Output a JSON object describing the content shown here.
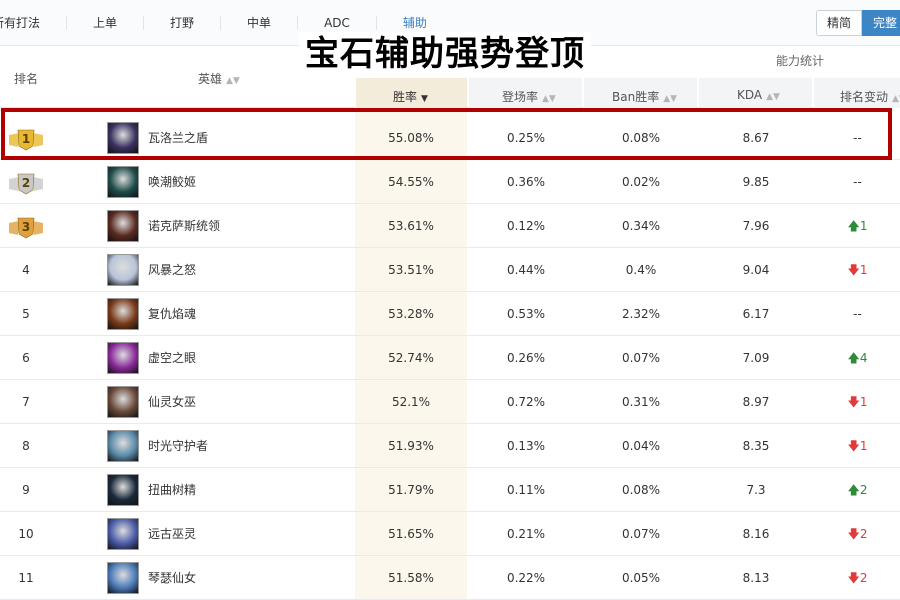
{
  "tabs": [
    "所有打法",
    "上单",
    "打野",
    "中单",
    "ADC",
    "辅助"
  ],
  "active_tab": "辅助",
  "view_toggle": [
    "精简",
    "完整"
  ],
  "overlay_title": "宝石辅助强势登顶",
  "header": {
    "rank": "排名",
    "hero": "英雄",
    "ability": "能力统计",
    "winrate": "胜率",
    "pickrate": "登场率",
    "banrate": "Ban胜率",
    "kda": "KDA",
    "rank_change": "排名变动"
  },
  "rows": [
    {
      "rank": "1",
      "medal": "gold",
      "hero": "瓦洛兰之盾",
      "win": "55.08%",
      "pick": "0.25%",
      "ban": "0.08%",
      "kda": "8.67",
      "change": "--",
      "dir": "none",
      "color": "#3a3160"
    },
    {
      "rank": "2",
      "medal": "silver",
      "hero": "唤潮鲛姬",
      "win": "54.55%",
      "pick": "0.36%",
      "ban": "0.02%",
      "kda": "9.85",
      "change": "--",
      "dir": "none",
      "color": "#1f4d4a"
    },
    {
      "rank": "3",
      "medal": "bronze",
      "hero": "诺克萨斯统领",
      "win": "53.61%",
      "pick": "0.12%",
      "ban": "0.34%",
      "kda": "7.96",
      "change": "1",
      "dir": "up",
      "color": "#5a2a20"
    },
    {
      "rank": "4",
      "medal": "",
      "hero": "风暴之怒",
      "win": "53.51%",
      "pick": "0.44%",
      "ban": "0.4%",
      "kda": "9.04",
      "change": "1",
      "dir": "down",
      "color": "#b8c4d8"
    },
    {
      "rank": "5",
      "medal": "",
      "hero": "复仇焰魂",
      "win": "53.28%",
      "pick": "0.53%",
      "ban": "2.32%",
      "kda": "6.17",
      "change": "--",
      "dir": "none",
      "color": "#7a3a1a"
    },
    {
      "rank": "6",
      "medal": "",
      "hero": "虚空之眼",
      "win": "52.74%",
      "pick": "0.26%",
      "ban": "0.07%",
      "kda": "7.09",
      "change": "4",
      "dir": "up",
      "color": "#8a2a9a"
    },
    {
      "rank": "7",
      "medal": "",
      "hero": "仙灵女巫",
      "win": "52.1%",
      "pick": "0.72%",
      "ban": "0.31%",
      "kda": "8.97",
      "change": "1",
      "dir": "down",
      "color": "#6a4a3a"
    },
    {
      "rank": "8",
      "medal": "",
      "hero": "时光守护者",
      "win": "51.93%",
      "pick": "0.13%",
      "ban": "0.04%",
      "kda": "8.35",
      "change": "1",
      "dir": "down",
      "color": "#5a8aa8"
    },
    {
      "rank": "9",
      "medal": "",
      "hero": "扭曲树精",
      "win": "51.79%",
      "pick": "0.11%",
      "ban": "0.08%",
      "kda": "7.3",
      "change": "2",
      "dir": "up",
      "color": "#1a2a3a"
    },
    {
      "rank": "10",
      "medal": "",
      "hero": "远古巫灵",
      "win": "51.65%",
      "pick": "0.21%",
      "ban": "0.07%",
      "kda": "8.16",
      "change": "2",
      "dir": "down",
      "color": "#4a5aa8"
    },
    {
      "rank": "11",
      "medal": "",
      "hero": "琴瑟仙女",
      "win": "51.58%",
      "pick": "0.22%",
      "ban": "0.05%",
      "kda": "8.13",
      "change": "2",
      "dir": "down",
      "color": "#4a7ab8"
    }
  ],
  "colors": {
    "accent": "#3b7fc4",
    "highlight_border": "#b00000",
    "up": "#2e8b3a",
    "down": "#e03a3a",
    "gold": "#e8b830",
    "silver": "#c8c8c8",
    "bronze": "#e0a040"
  }
}
